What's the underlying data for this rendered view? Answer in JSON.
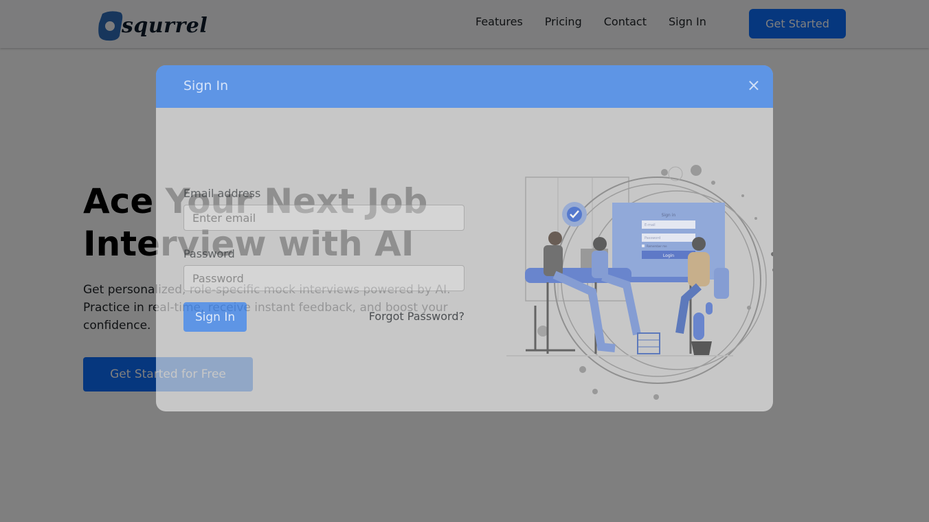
{
  "navbar": {
    "brand": "squrrel",
    "links": [
      "Features",
      "Pricing",
      "Contact",
      "Sign In"
    ],
    "cta_label": "Get Started"
  },
  "hero": {
    "title_line1": "Ace Your Next Job",
    "title_line2": "Interview with AI",
    "subtitle": "Get personalized, role-specific mock interviews powered by AI. Practice in real-time, receive instant feedback, and boost your confidence.",
    "cta_label": "Get Started for Free"
  },
  "modal": {
    "title": "Sign In",
    "close_symbol": "×",
    "email_label": "Email address",
    "email_placeholder": "Enter email",
    "email_value": "",
    "password_label": "Password",
    "password_placeholder": "Password",
    "password_value": "",
    "submit_label": "Sign In",
    "forgot_label": "Forgot Password?",
    "illustration": {
      "panel_title": "Sign in",
      "email_placeholder": "E-mail",
      "password_placeholder": "Password",
      "remember_label": "Remember me",
      "login_label": "Login"
    }
  },
  "colors": {
    "primary": "#0d6efd",
    "navbar_bg": "#f8f9fa",
    "backdrop": "rgba(0,0,0,0.5)",
    "logo_blue": "#2f6db8"
  },
  "icons": {
    "logo": "squirrel-logo-icon",
    "close": "close-icon",
    "check": "check-circle-icon"
  }
}
